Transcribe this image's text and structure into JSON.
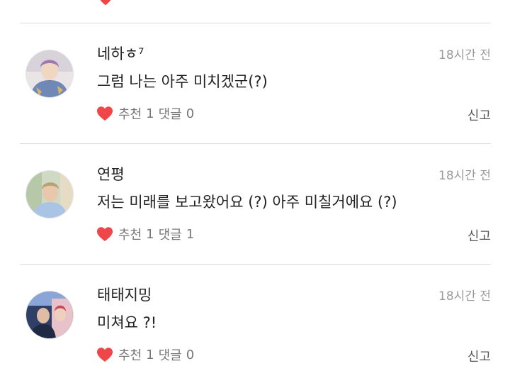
{
  "colors": {
    "heart": "#f0464a",
    "divider": "#dcdcdc",
    "time": "#9a9a9a"
  },
  "comments": [
    {
      "author": "네하ㅎ⁷",
      "time": "18시간 전",
      "text": "그럼 나는 아주 미치겠군(?)",
      "like_label": "추천",
      "like_count": "1",
      "reply_label": "댓글",
      "reply_count": "0",
      "report_label": "신고",
      "avatar_icon": "avatar-photo",
      "heart_icon": "heart-icon"
    },
    {
      "author": "연평",
      "time": "18시간 전",
      "text": "저는 미래를 보고왔어요 (?) 아주 미칠거에요 (?)",
      "like_label": "추천",
      "like_count": "1",
      "reply_label": "댓글",
      "reply_count": "1",
      "report_label": "신고",
      "avatar_icon": "avatar-photo",
      "heart_icon": "heart-icon"
    },
    {
      "author": "태태지밍",
      "time": "18시간 전",
      "text": "미쳐요 ?!",
      "like_label": "추천",
      "like_count": "1",
      "reply_label": "댓글",
      "reply_count": "0",
      "report_label": "신고",
      "avatar_icon": "avatar-photo",
      "heart_icon": "heart-icon"
    }
  ]
}
